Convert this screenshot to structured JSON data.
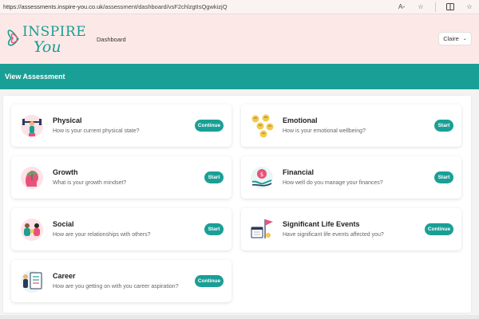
{
  "browser": {
    "url_host": "https://assessments.inspire-you.co.uk",
    "url_path": "/assessment/dashboard/vsF2chlzgtIsQgwkizjQ"
  },
  "header": {
    "logo_line1": "INSPIRE",
    "logo_line2": "You",
    "nav_dashboard": "Dashboard",
    "user_name": "Claire",
    "user_chevron": "⌄"
  },
  "page_title": "View Assessment",
  "cards": [
    {
      "title": "Physical",
      "subtitle": "How is your current physical state?",
      "button": "Continue"
    },
    {
      "title": "Emotional",
      "subtitle": "How is your emotional wellbeing?",
      "button": "Start"
    },
    {
      "title": "Growth",
      "subtitle": "What is your growth mindset?",
      "button": "Start"
    },
    {
      "title": "Financial",
      "subtitle": "How well do you manage your finances?",
      "button": "Start"
    },
    {
      "title": "Social",
      "subtitle": "How are your relationships with others?",
      "button": "Start"
    },
    {
      "title": "Significant Life Events",
      "subtitle": "Have significant life events affected you?",
      "button": "Continue"
    },
    {
      "title": "Career",
      "subtitle": "How are you getting on with you career aspiration?",
      "button": "Continue"
    }
  ],
  "colors": {
    "teal": "#1a9f96",
    "header_bg": "#fce9e7",
    "pink_accent": "#e8527a"
  }
}
